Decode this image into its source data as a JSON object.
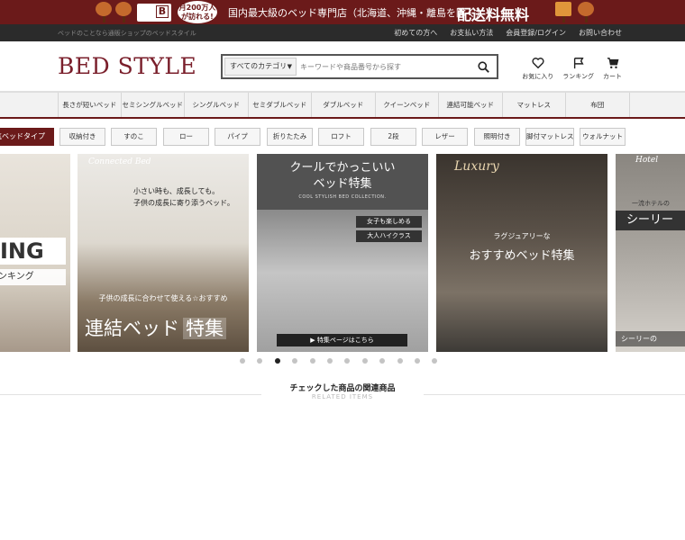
{
  "promo": {
    "truck_letter": "B",
    "visitors_line1": "月200万人",
    "visitors_line2": "が訪れる!",
    "main_text": "国内最大級のベッド専門店（北海道、沖縄・離島を除く）",
    "shipping_text": "配送料無料"
  },
  "utility": {
    "tagline": "ベッドのことなら通販ショップのベッドスタイル",
    "links": [
      "初めての方へ",
      "お支払い方法",
      "会員登録/ログイン",
      "お問い合わせ"
    ]
  },
  "header": {
    "logo": "BED STYLE",
    "search": {
      "category": "すべてのカテゴリ",
      "placeholder": "キーワードや商品番号から探す"
    },
    "icons": [
      {
        "name": "heart-icon",
        "label": "お気に入り"
      },
      {
        "name": "flag-icon",
        "label": "ランキング"
      },
      {
        "name": "cart-icon",
        "label": "カート"
      }
    ]
  },
  "nav": {
    "items": [
      "長さが短いベッド",
      "セミシングルベッド",
      "シングルベッド",
      "セミダブルベッド",
      "ダブルベッド",
      "クイーンベッド",
      "連結可能ベッド",
      "マットレス",
      "布団"
    ]
  },
  "tags": {
    "label": "人気ベッドタイプ",
    "items": [
      "収納付き",
      "すのこ",
      "ロー",
      "パイプ",
      "折りたたみ",
      "ロフト",
      "2段",
      "レザー",
      "照明付き",
      "脚付マットレス",
      "ウォルナット"
    ]
  },
  "carousel": {
    "slides": [
      {
        "rk1": "ING",
        "rk2": "ンキング"
      },
      {
        "script": "Connected Bed",
        "t1a": "小さい時も、成長しても。",
        "t1b": "子供の成長に寄り添うベッド。",
        "t2": "子供の成長に合わせて使える☆おすすめ",
        "t3": "連結ベッド",
        "t3b": "特集"
      },
      {
        "h1a": "クールでかっこいい",
        "h1b": "ベッド特集",
        "h2": "COOL STYLISH BED COLLECTION.",
        "badge1": "女子も楽しめる",
        "badge2": "大人ハイクラス",
        "cta": "▶ 特集ページはこちら"
      },
      {
        "script": "Luxury",
        "t1": "ラグジュアリーな",
        "t2": "おすすめベッド特集"
      },
      {
        "script": "Hotel",
        "t1": "一流ホテルの",
        "t2": "シーリー",
        "t3": "シーリーの"
      }
    ],
    "dot_count": 12,
    "active_index": 2
  },
  "related": {
    "title": "チェックした商品の関連商品",
    "subtitle": "RELATED ITEMS"
  }
}
